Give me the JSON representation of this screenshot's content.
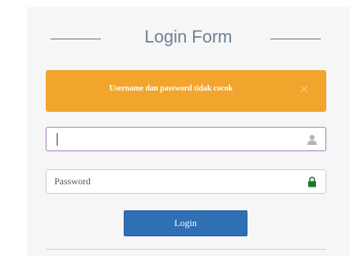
{
  "form": {
    "title": "Login Form",
    "alert": {
      "message": "Username dan password tidak cocok",
      "color": "#f2a52d"
    },
    "username": {
      "value": "",
      "placeholder": "",
      "icon": "user-icon"
    },
    "password": {
      "value": "",
      "placeholder": "Password",
      "icon": "lock-icon"
    },
    "login_label": "Login",
    "accent_color": "#2f6fb3"
  }
}
